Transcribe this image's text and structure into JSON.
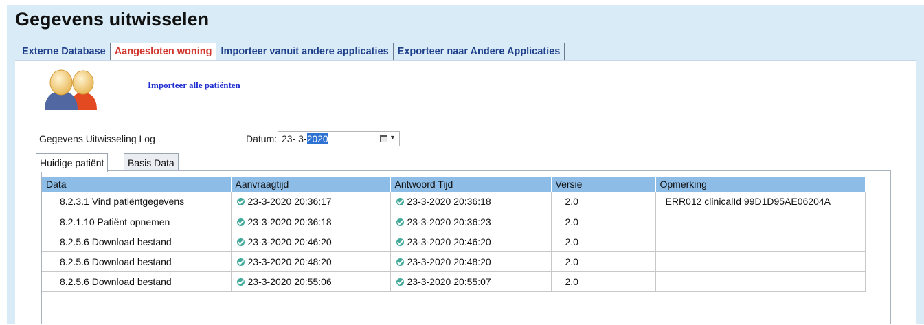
{
  "window": {
    "title": "Gegevens uitwisselen"
  },
  "tabs": [
    {
      "label": "Externe Database",
      "active": false
    },
    {
      "label": "Aangesloten woning",
      "active": true
    },
    {
      "label": "Importeer vanuit andere applicaties",
      "active": false
    },
    {
      "label": "Exporteer naar Andere Applicaties",
      "active": false
    }
  ],
  "actions": {
    "import_all": "Importeer alle patiënten"
  },
  "log": {
    "label": "Gegevens Uitwisseling Log",
    "date_label": "Datum:",
    "date_prefix": "23- 3-",
    "date_selected": "2020"
  },
  "subtabs": [
    {
      "label": "Huidige patiënt",
      "active": true
    },
    {
      "label": "Basis Data",
      "active": false
    }
  ],
  "table": {
    "columns": [
      "Data",
      "Aanvraagtijd",
      "Antwoord Tijd",
      "Versie",
      "Opmerking"
    ],
    "rows": [
      [
        "8.2.3.1 Vind patiëntgegevens",
        "23-3-2020 20:36:17",
        "23-3-2020 20:36:18",
        "2.0",
        "ERR012 clinicalId 99D1D95AE06204A"
      ],
      [
        "8.2.1.10 Patiënt opnemen",
        "23-3-2020 20:36:18",
        "23-3-2020 20:36:23",
        "2.0",
        ""
      ],
      [
        "8.2.5.6 Download bestand",
        "23-3-2020 20:46:20",
        "23-3-2020 20:46:20",
        "2.0",
        ""
      ],
      [
        "8.2.5.6 Download bestand",
        "23-3-2020 20:48:20",
        "23-3-2020 20:48:20",
        "2.0",
        ""
      ],
      [
        "8.2.5.6 Download bestand",
        "23-3-2020 20:55:06",
        "23-3-2020 20:55:07",
        "2.0",
        ""
      ]
    ]
  },
  "colors": {
    "header_bg": "#8dbde6",
    "frame_bg": "#d9ebf7",
    "active_tab": "#d0352b",
    "tab_text": "#1e3f8a",
    "status_ok": "#42a99b",
    "link": "#1f2ecf"
  },
  "icons": {
    "avatar": "users-icon",
    "status": "check-circle-icon",
    "calendar": "calendar-icon"
  }
}
